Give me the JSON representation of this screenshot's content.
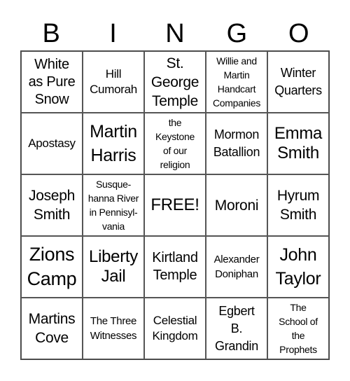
{
  "header": {
    "letters": [
      "B",
      "I",
      "N",
      "G",
      "O"
    ]
  },
  "cells": [
    "White\nas Pure\nSnow",
    "Hill\nCumorah",
    "St.\nGeorge\nTemple",
    "Willie and\nMartin\nHandcart\nCompanies",
    "Winter\nQuarters",
    "Apostasy",
    "Martin\nHarris",
    "the\nKeystone\nof our\nreligion",
    "Mormon\nBatallion",
    "Emma\nSmith",
    "Joseph\nSmith",
    "Susque-\nhanna River\nin Pennisyl-\nvania",
    "FREE!",
    "Moroni",
    "Hyrum\nSmith",
    "Zions\nCamp",
    "Liberty\nJail",
    "Kirtland\nTemple",
    "Alexander\nDoniphan",
    "John\nTaylor",
    "Martins\nCove",
    "The Three\nWitnesses",
    "Celestial\nKingdom",
    "Egbert\nB.\nGrandin",
    "The\nSchool of\nthe\nProphets"
  ]
}
